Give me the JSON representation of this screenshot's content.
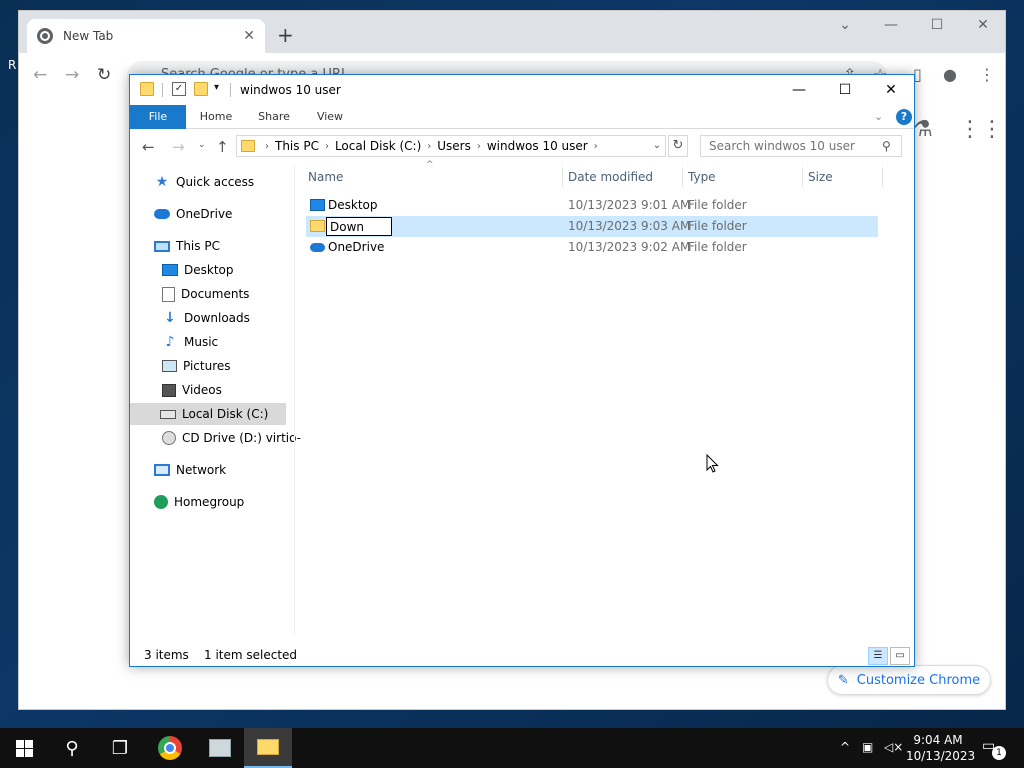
{
  "desktop": {
    "edge_label": "R"
  },
  "chrome": {
    "tab_title": "New Tab",
    "tab_close": "✕",
    "new_tab": "+",
    "omnibox_placeholder": "Search Google or type a URL",
    "customize_label": "Customize Chrome"
  },
  "explorer": {
    "title": "windwos 10 user",
    "ribbon_tabs": [
      "File",
      "Home",
      "Share",
      "View"
    ],
    "breadcrumbs": [
      "This PC",
      "Local Disk (C:)",
      "Users",
      "windwos 10 user"
    ],
    "search_placeholder": "Search windwos 10 user",
    "nav_items": [
      {
        "label": "Quick access",
        "icon": "star-icon"
      },
      {
        "label": "OneDrive",
        "icon": "onedrive-icon"
      },
      {
        "label": "This PC",
        "icon": "computer-icon"
      },
      {
        "label": "Desktop",
        "icon": "desktop-icon"
      },
      {
        "label": "Documents",
        "icon": "documents-icon"
      },
      {
        "label": "Downloads",
        "icon": "downloads-icon"
      },
      {
        "label": "Music",
        "icon": "music-icon"
      },
      {
        "label": "Pictures",
        "icon": "pictures-icon"
      },
      {
        "label": "Videos",
        "icon": "videos-icon"
      },
      {
        "label": "Local Disk (C:)",
        "icon": "disk-icon",
        "selected": true
      },
      {
        "label": "CD Drive (D:) virtio-",
        "icon": "cd-drive-icon"
      },
      {
        "label": "Network",
        "icon": "network-icon"
      },
      {
        "label": "Homegroup",
        "icon": "homegroup-icon"
      }
    ],
    "columns": [
      "Name",
      "Date modified",
      "Type",
      "Size"
    ],
    "files": [
      {
        "name": "Desktop",
        "date": "10/13/2023 9:01 AM",
        "type": "File folder",
        "icon": "desktop-folder-icon"
      },
      {
        "name": "Down",
        "date": "10/13/2023 9:03 AM",
        "type": "File folder",
        "icon": "folder-icon",
        "selected": true,
        "renaming": true
      },
      {
        "name": "OneDrive",
        "date": "10/13/2023 9:02 AM",
        "type": "File folder",
        "icon": "onedrive-folder-icon"
      }
    ],
    "status": {
      "count": "3 items",
      "selection": "1 item selected"
    }
  },
  "taskbar": {
    "time": "9:04 AM",
    "date": "10/13/2023",
    "notification_count": "1"
  },
  "colors": {
    "accent": "#1979ca",
    "selection": "#cce8ff",
    "nav_selected": "#d9d9d9",
    "chrome_link": "#1a73e8"
  }
}
